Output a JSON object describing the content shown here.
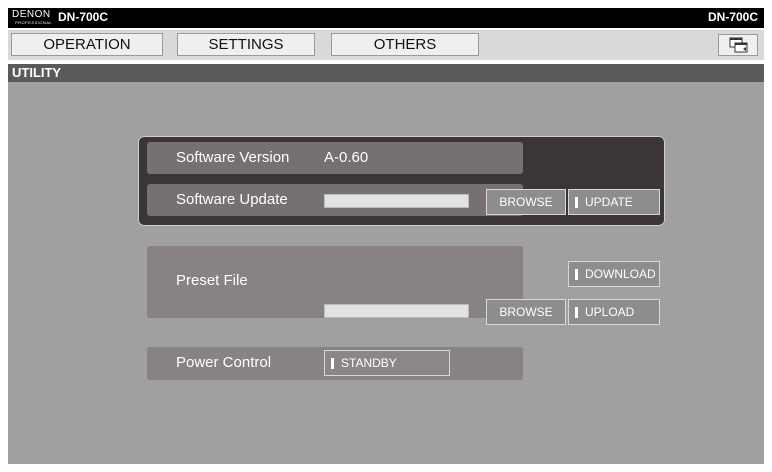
{
  "topbar": {
    "brand": "DENON",
    "brand_sub": "PROFESSIONAL",
    "model_left": "DN-700C",
    "model_right": "DN-700C"
  },
  "tabs": [
    {
      "label": "OPERATION"
    },
    {
      "label": "SETTINGS"
    },
    {
      "label": "OTHERS"
    }
  ],
  "section": {
    "title": "UTILITY"
  },
  "software": {
    "version_label": "Software Version",
    "version_value": "A-0.60",
    "update_label": "Software Update",
    "browse_label": "BROWSE",
    "update_button": "UPDATE"
  },
  "preset": {
    "label": "Preset File",
    "download_button": "DOWNLOAD",
    "browse_label": "BROWSE",
    "upload_button": "UPLOAD"
  },
  "power": {
    "label": "Power Control",
    "standby_button": "STANDBY"
  },
  "icons": {
    "window_switch": "window-switch-icon"
  },
  "colors": {
    "topbar": "#000000",
    "section_header": "#5a5a5a",
    "main_bg": "#a0a0a0",
    "dark_panel": "#3c3535",
    "button": "#8d8d8d"
  }
}
